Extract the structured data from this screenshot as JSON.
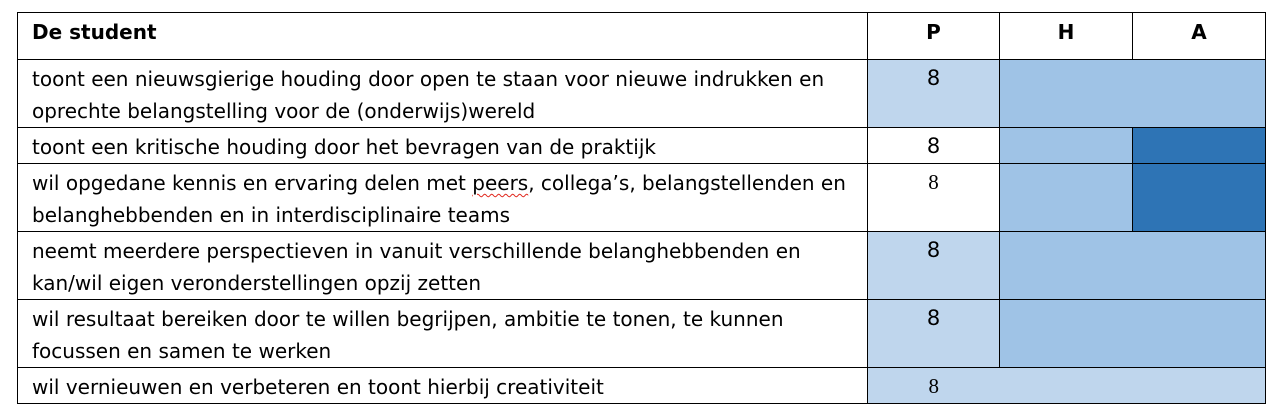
{
  "header": {
    "col0": "De student",
    "col1": "P",
    "col2": "H",
    "col3": "A"
  },
  "rows": [
    {
      "text": "toont een nieuwsgierige houding door open te staan voor nieuwe indrukken en oprechte belangstelling voor de (onderwijs)wereld",
      "p": "8"
    },
    {
      "text": "toont een kritische houding door het bevragen van de praktijk",
      "p": "8"
    },
    {
      "text_before": "wil opgedane kennis en ervaring delen met ",
      "text_marked": "peers",
      "text_after": ", collega’s, belangstellenden en belanghebbenden en in interdisciplinaire teams",
      "p": "8"
    },
    {
      "text": "neemt meerdere perspectieven in vanuit verschillende belanghebbenden en kan/wil eigen veronderstellingen opzij zetten",
      "p": "8"
    },
    {
      "text": "wil resultaat bereiken door te willen begrijpen, ambitie te tonen, te kunnen focussen en samen te werken",
      "p": "8"
    },
    {
      "text": "wil vernieuwen en verbeteren en toont hierbij creativiteit",
      "p": "8"
    }
  ],
  "colors": {
    "light": "#bfd6ed",
    "mid": "#9fc3e6",
    "dark": "#2e74b5"
  }
}
